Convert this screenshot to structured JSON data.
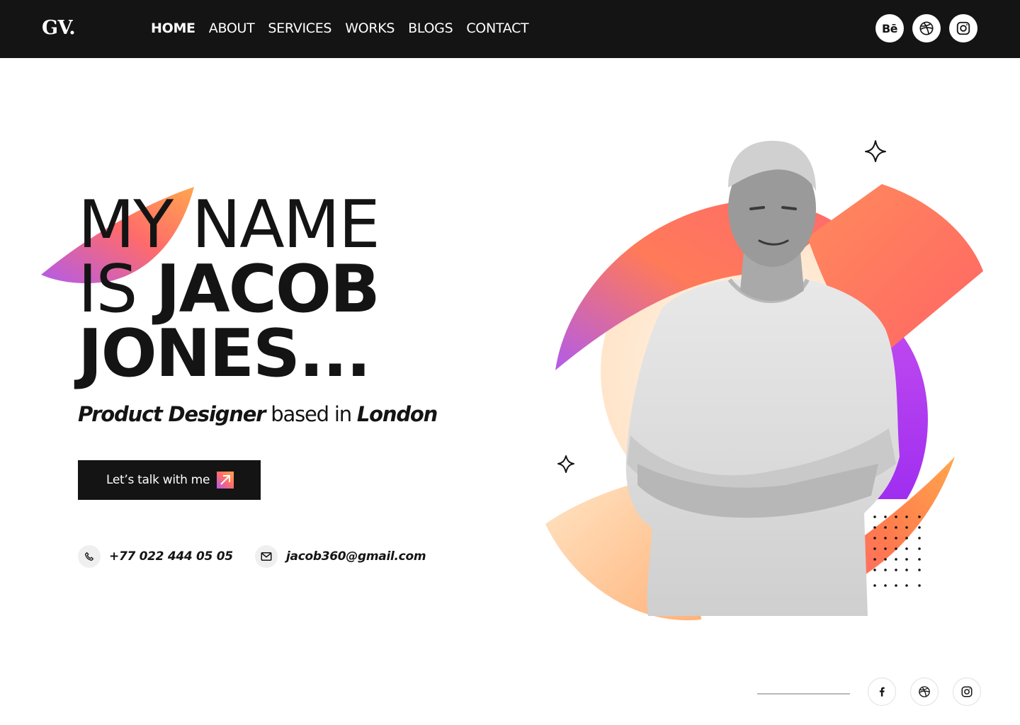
{
  "header": {
    "logo": "GV.",
    "nav": [
      {
        "label": "HOME",
        "active": true
      },
      {
        "label": "ABOUT",
        "active": false
      },
      {
        "label": "SERVICES",
        "active": false
      },
      {
        "label": "WORKS",
        "active": false
      },
      {
        "label": "BLOGS",
        "active": false
      },
      {
        "label": "CONTACT",
        "active": false
      }
    ],
    "social": [
      {
        "icon": "behance-icon",
        "text": "Bē"
      },
      {
        "icon": "dribbble-icon"
      },
      {
        "icon": "instagram-icon"
      }
    ]
  },
  "hero": {
    "line1": "MY NAME",
    "line2_light": "IS ",
    "line2_bold": "JACOB",
    "line3": "JONES...",
    "subtitle": {
      "role": "Product Designer",
      "middle": " based in ",
      "city": "London"
    },
    "cta_label": "Let’s talk with me",
    "phone": "+77 022 444 05 05",
    "email": "jacob360@gmail.com"
  },
  "footer": {
    "social": [
      {
        "icon": "facebook-icon"
      },
      {
        "icon": "dribbble-icon"
      },
      {
        "icon": "instagram-icon"
      }
    ]
  },
  "colors": {
    "dark": "#141414",
    "gradient_start": "#b25bea",
    "gradient_mid": "#ff6b6b",
    "gradient_end": "#ffa64d",
    "accent_purple": "#b43cf0",
    "peach": "#ffe9d2"
  }
}
